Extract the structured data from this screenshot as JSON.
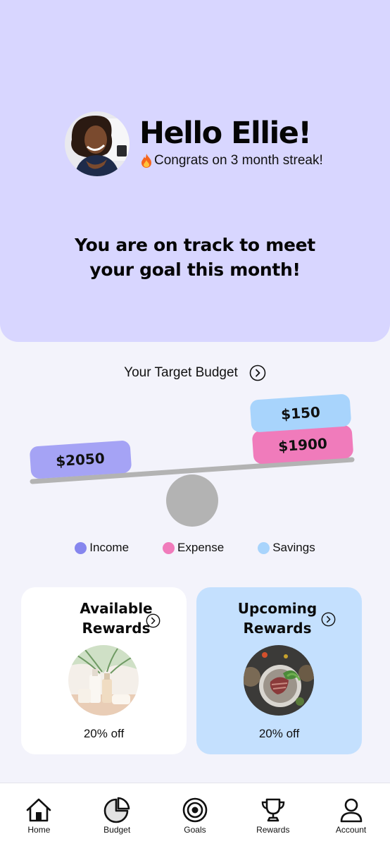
{
  "header": {
    "greeting": "Hello Ellie!",
    "streak_icon": "flame-icon",
    "streak_text": "Congrats on 3 month streak!",
    "status_message_line1": "You are on track to meet",
    "status_message_line2": "your goal this month!"
  },
  "budget": {
    "title": "Your Target Budget",
    "income": "$2050",
    "expense": "$1900",
    "savings": "$150",
    "legend": [
      {
        "label": "Income",
        "color": "#8686ee"
      },
      {
        "label": "Expense",
        "color": "#f07bbb"
      },
      {
        "label": "Savings",
        "color": "#a8d4fc"
      }
    ]
  },
  "rewards": {
    "available": {
      "title_line1": "Available",
      "title_line2": "Rewards",
      "offer": "20% off"
    },
    "upcoming": {
      "title_line1": "Upcoming",
      "title_line2": "Rewards",
      "offer": "20% off"
    }
  },
  "nav": [
    {
      "label": "Home",
      "icon": "home-icon"
    },
    {
      "label": "Budget",
      "icon": "pie-chart-icon"
    },
    {
      "label": "Goals",
      "icon": "target-icon"
    },
    {
      "label": "Rewards",
      "icon": "trophy-icon"
    },
    {
      "label": "Account",
      "icon": "user-icon"
    }
  ],
  "colors": {
    "hero_bg": "#d8d6ff",
    "income": "#a5a3f5",
    "expense": "#f07bbb",
    "savings": "#a8d4fc",
    "upcoming_card": "#c4e0fe"
  }
}
